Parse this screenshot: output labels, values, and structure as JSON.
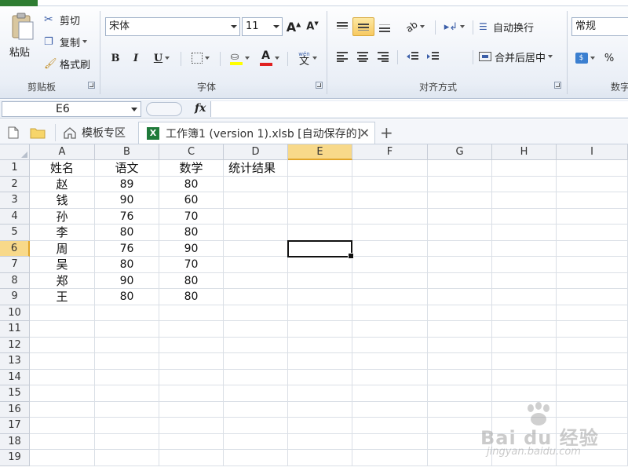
{
  "ribbon": {
    "clipboard": {
      "paste_label": "粘贴",
      "cut_label": "剪切",
      "copy_label": "复制",
      "format_painter_label": "格式刷",
      "group_label": "剪贴板"
    },
    "font": {
      "font_name": "宋体",
      "font_size": "11",
      "bold": "B",
      "italic": "I",
      "underline": "U",
      "wen_label": "wén",
      "font_color_letter": "A",
      "group_label": "字体"
    },
    "alignment": {
      "wrap_text_label": "自动换行",
      "merge_center_label": "合并后居中",
      "group_label": "对齐方式"
    },
    "number": {
      "format": "常规",
      "percent": "%",
      "group_label": "数字"
    }
  },
  "formula_bar": {
    "name_box": "E6",
    "fx_label": "fx",
    "formula": ""
  },
  "tabs": [
    {
      "label": "模板专区"
    },
    {
      "label": "工作簿1 (version 1).xlsb [自动保存的]"
    }
  ],
  "columns": [
    "A",
    "B",
    "C",
    "D",
    "E",
    "F",
    "G",
    "H",
    "I"
  ],
  "rows": [
    "1",
    "2",
    "3",
    "4",
    "5",
    "6",
    "7",
    "8",
    "9",
    "10",
    "11",
    "12",
    "13",
    "14",
    "15",
    "16",
    "17",
    "18",
    "19"
  ],
  "active_cell": {
    "col": "E",
    "row": "6"
  },
  "cells": [
    [
      "姓名",
      "语文",
      "数学",
      "统计结果"
    ],
    [
      "赵",
      "89",
      "80",
      ""
    ],
    [
      "钱",
      "90",
      "60",
      ""
    ],
    [
      "孙",
      "76",
      "70",
      ""
    ],
    [
      "李",
      "80",
      "80",
      ""
    ],
    [
      "周",
      "76",
      "90",
      ""
    ],
    [
      "吴",
      "80",
      "70",
      ""
    ],
    [
      "郑",
      "90",
      "80",
      ""
    ],
    [
      "王",
      "80",
      "80",
      ""
    ]
  ],
  "watermark": {
    "brand": "Bai du 经验",
    "url": "jingyan.baidu.com"
  }
}
